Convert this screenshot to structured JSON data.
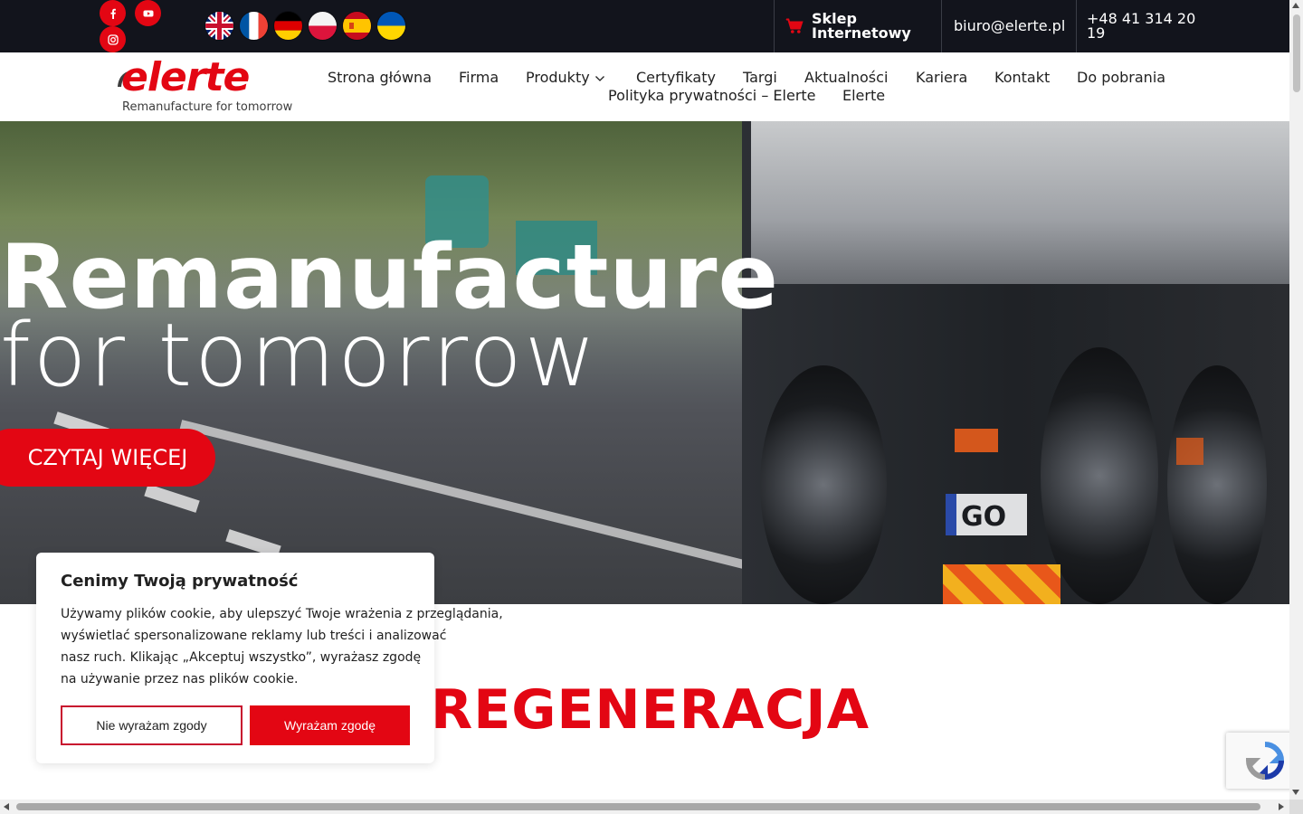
{
  "topbar": {
    "social": [
      "facebook-icon",
      "youtube-icon",
      "instagram-icon"
    ],
    "languages": [
      "English",
      "Français",
      "Deutsch",
      "Polski",
      "Español",
      "Українська"
    ],
    "shop_label_line1": "Sklep",
    "shop_label_line2": "Internetowy",
    "email": "biuro@elerte.pl",
    "phone_line1": "+48 41 314 20",
    "phone_line2": "19"
  },
  "header": {
    "logo_word": "elerte",
    "logo_tagline": "Remanufacture for tomorrow",
    "nav": [
      "Strona główna",
      "Firma",
      "Produkty",
      "Certyfikaty",
      "Targi",
      "Aktualności",
      "Kariera",
      "Kontakt",
      "Do pobrania",
      "Polityka prywatności – Elerte",
      "Elerte"
    ]
  },
  "hero": {
    "title_line1": "Remanufacture",
    "title_line2": "for tomorrow",
    "cta": "CZYTAJ WIĘCEJ",
    "plate_text": "GO"
  },
  "section": {
    "heading": "REGENERACJA"
  },
  "cookie": {
    "title": "Cenimy Twoją prywatność",
    "line1": "Używamy plików cookie, aby ulepszyć Twoje wrażenia z przeglądania,",
    "line2": "wyświetlać spersonalizowane reklamy lub treści i analizować",
    "line3": "nasz ruch. Klikając „Akceptuj wszystko”, wyrażasz zgodę",
    "line4": "na używanie przez nas plików cookie.",
    "reject": "Nie wyrażam zgody",
    "accept": "Wyrażam zgodę"
  },
  "colors": {
    "brand_red": "#e30613",
    "topbar_bg": "#12141c"
  }
}
